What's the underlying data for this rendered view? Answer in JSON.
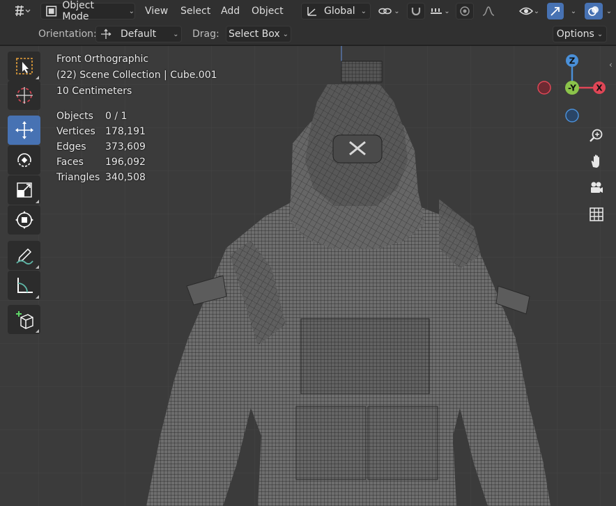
{
  "header": {
    "mode": "Object Mode",
    "menus": [
      "View",
      "Select",
      "Add",
      "Object"
    ],
    "transform_orientation": "Global"
  },
  "toolsettings": {
    "orientation_label": "Orientation:",
    "orientation_value": "Default",
    "drag_label": "Drag:",
    "drag_value": "Select Box",
    "options_label": "Options"
  },
  "viewport_info": {
    "view": "Front Orthographic",
    "collection": "(22) Scene Collection | Cube.001",
    "scale": "10 Centimeters"
  },
  "stats": [
    {
      "label": "Objects",
      "value": "0 / 1"
    },
    {
      "label": "Vertices",
      "value": "178,191"
    },
    {
      "label": "Edges",
      "value": "373,609"
    },
    {
      "label": "Faces",
      "value": "196,092"
    },
    {
      "label": "Triangles",
      "value": "340,508"
    }
  ],
  "gizmo": {
    "z": "Z",
    "y": "-Y",
    "x": "X"
  },
  "colors": {
    "accent": "#4772b3",
    "x_axis": "#e04656",
    "y_axis": "#8bc34a",
    "z_axis": "#4a90d9"
  },
  "icons": {
    "toolbar": [
      "select-box-icon",
      "cursor-icon",
      "move-icon",
      "rotate-icon",
      "scale-icon",
      "transform-icon",
      "annotate-icon",
      "measure-icon",
      "add-cube-icon"
    ],
    "nav": [
      "zoom-icon",
      "hand-icon",
      "camera-icon",
      "grid-icon"
    ]
  }
}
